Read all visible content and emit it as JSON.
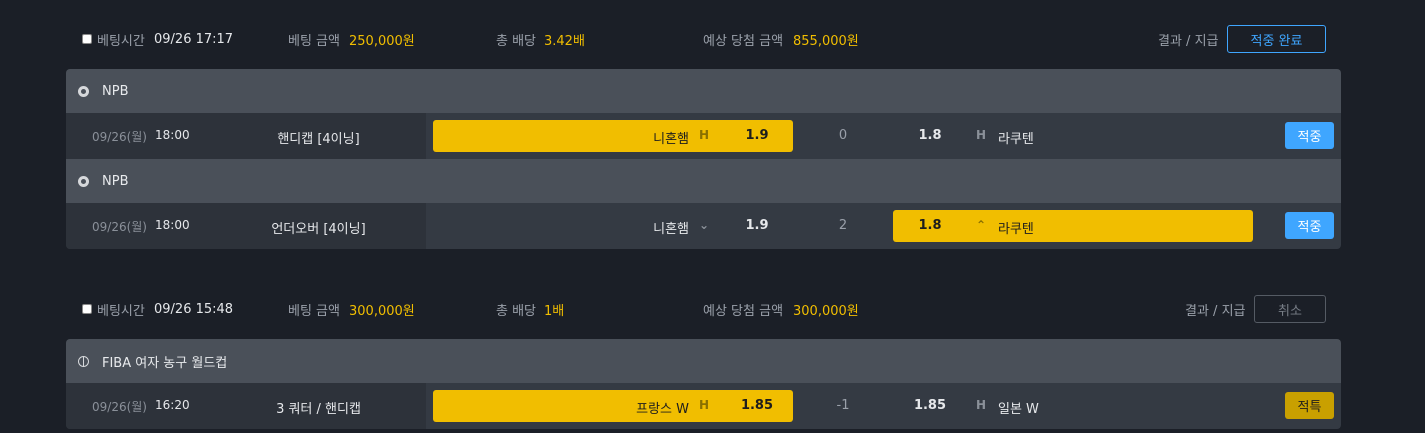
{
  "bets": [
    {
      "time_label": "베팅시간",
      "time": "09/26 17:17",
      "amount_label": "베팅 금액",
      "amount": "250,000원",
      "odds_label": "총 배당",
      "odds": "3.42배",
      "expected_label": "예상 당첨 금액",
      "expected": "855,000원",
      "result_label": "결과 / 지급",
      "result_button": "적중 완료",
      "games": [
        {
          "league": "NPB",
          "date": "09/26(월)",
          "time": "18:00",
          "market": "핸디캡 [4이닝]",
          "home": "니혼햄",
          "home_icon": "H",
          "home_odd": "1.9",
          "line": "0",
          "away_odd": "1.8",
          "away_icon": "H",
          "away": "라쿠텐",
          "status": "적중",
          "selected": "home"
        },
        {
          "league": "NPB",
          "date": "09/26(월)",
          "time": "18:00",
          "market": "언더오버 [4이닝]",
          "home": "니혼햄",
          "home_icon": "⌄",
          "home_odd": "1.9",
          "line": "2",
          "away_odd": "1.8",
          "away_icon": "⌃",
          "away": "라쿠텐",
          "status": "적중",
          "selected": "away"
        }
      ]
    },
    {
      "time_label": "베팅시간",
      "time": "09/26 15:48",
      "amount_label": "베팅 금액",
      "amount": "300,000원",
      "odds_label": "총 배당",
      "odds": "1배",
      "expected_label": "예상 당첨 금액",
      "expected": "300,000원",
      "result_label": "결과 / 지급",
      "result_button": "취소",
      "games": [
        {
          "league": "FIBA 여자 농구 월드컵",
          "date": "09/26(월)",
          "time": "16:20",
          "market": "3 쿼터 / 핸디캡",
          "home": "프랑스 W",
          "home_icon": "H",
          "home_odd": "1.85",
          "line": "-1",
          "away_odd": "1.85",
          "away_icon": "H",
          "away": "일본 W",
          "status": "적특",
          "selected": "home"
        }
      ]
    }
  ],
  "colors": {
    "accent_gold": "#f1be00",
    "accent_blue": "#3fa6ff",
    "background": "#1b1f27"
  }
}
